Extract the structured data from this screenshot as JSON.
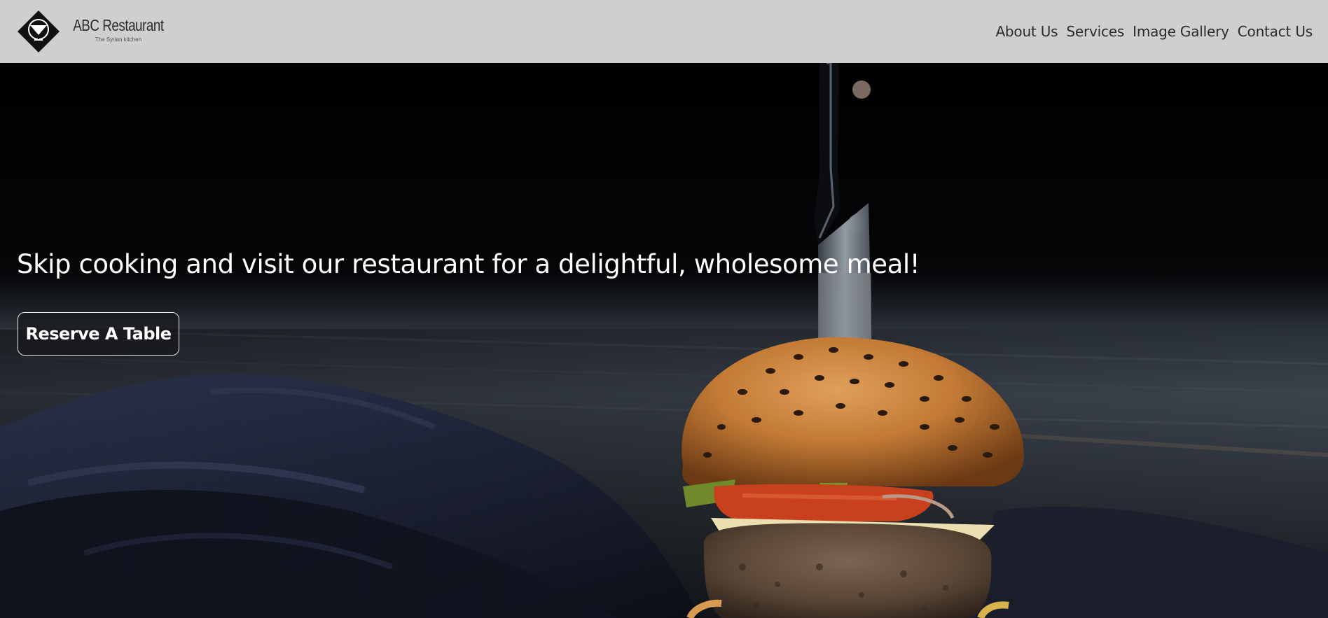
{
  "brand": {
    "name": "ABC Restaurant",
    "tagline": "The Syrian kitchen",
    "logo_icon": "cocktail-glass-diamond-icon"
  },
  "nav": {
    "items": [
      {
        "label": "About Us"
      },
      {
        "label": "Services"
      },
      {
        "label": "Image Gallery"
      },
      {
        "label": "Contact Us"
      }
    ]
  },
  "hero": {
    "headline": "Skip cooking and visit our restaurant for a delightful, wholesome meal!",
    "cta_label": "Reserve A Table",
    "image_subject": "burger-with-knife-photo"
  },
  "colors": {
    "navbar_bg": "#cfcfcf",
    "nav_text": "#2b2b2b",
    "hero_text": "#ffffff"
  }
}
